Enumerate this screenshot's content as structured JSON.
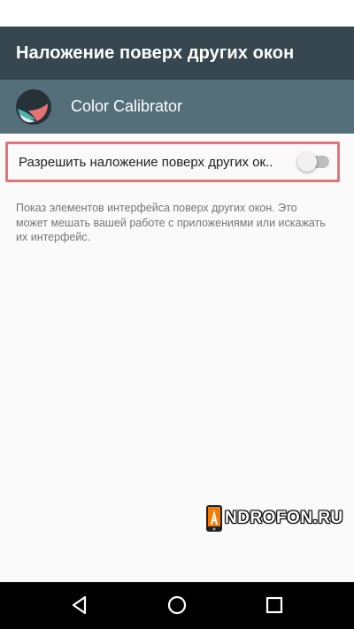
{
  "toolbar": {
    "title": "Наложение поверх других окон"
  },
  "app": {
    "name": "Color Calibrator",
    "icon": "color-calibrator-icon"
  },
  "setting": {
    "label": "Разрешить наложение поверх других ок..",
    "enabled": false
  },
  "description": "Показ элементов интерфейса поверх других окон. Это может мешать вашей работе с приложениями или искажать их интерфейс.",
  "watermark": {
    "text": "NDROFON.RU",
    "icon": "androfon-logo-icon"
  },
  "nav": {
    "back": "back-icon",
    "home": "home-icon",
    "recents": "recents-icon"
  },
  "colors": {
    "toolbar": "#37474f",
    "app_header": "#546e7a",
    "highlight": "#e5737a",
    "toggle_track": "#bdbdbd"
  }
}
